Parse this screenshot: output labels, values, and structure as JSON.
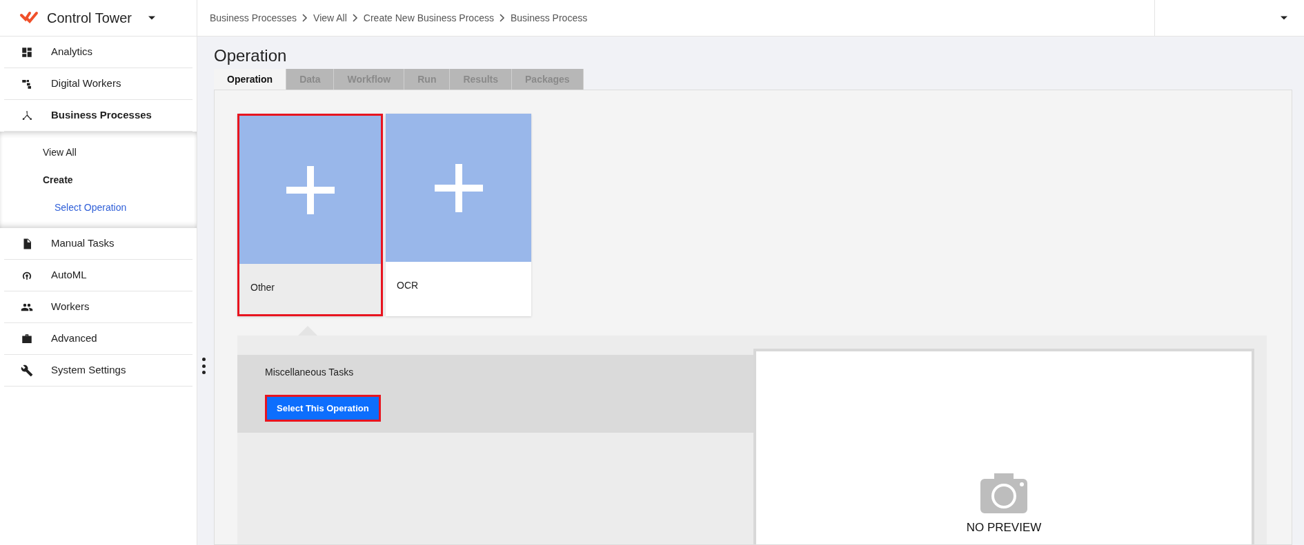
{
  "brand": {
    "name": "Control Tower"
  },
  "sidebar": {
    "items": [
      {
        "label": "Analytics",
        "expanded": false
      },
      {
        "label": "Digital Workers",
        "expanded": false
      },
      {
        "label": "Business Processes",
        "expanded": true,
        "children": [
          {
            "label": "View All",
            "expanded": false,
            "selected": false
          },
          {
            "label": "Create",
            "expanded": true,
            "selected": false,
            "children": [
              {
                "label": "Select Operation",
                "selected": true
              }
            ]
          }
        ]
      },
      {
        "label": "Manual Tasks",
        "expanded": false
      },
      {
        "label": "AutoML",
        "expanded": false
      },
      {
        "label": "Workers",
        "expanded": false
      },
      {
        "label": "Advanced",
        "expanded": false
      },
      {
        "label": "System Settings",
        "expanded": false
      }
    ]
  },
  "breadcrumb": [
    "Business Processes",
    "View All",
    "Create New Business Process",
    "Business Process"
  ],
  "page_title": "Operation",
  "tabs": [
    {
      "label": "Operation",
      "selected": true
    },
    {
      "label": "Data",
      "selected": false
    },
    {
      "label": "Workflow",
      "selected": false
    },
    {
      "label": "Run",
      "selected": false
    },
    {
      "label": "Results",
      "selected": false
    },
    {
      "label": "Packages",
      "selected": false
    }
  ],
  "operations": [
    {
      "label": "Other",
      "selected": true
    },
    {
      "label": "OCR",
      "selected": false
    }
  ],
  "details": {
    "title": "Miscellaneous Tasks",
    "button": "Select This Operation",
    "preview": "NO PREVIEW"
  }
}
